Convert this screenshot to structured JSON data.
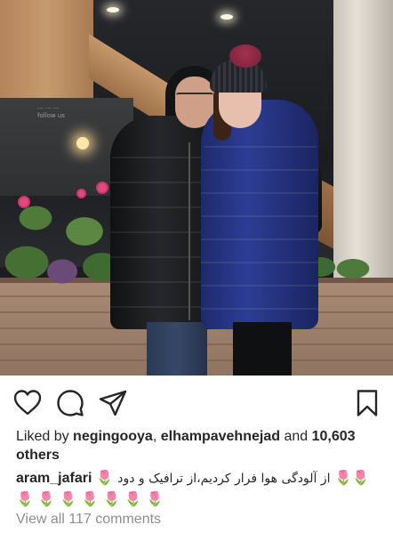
{
  "post": {
    "photo_alt": "",
    "window_sign_lines": [
      "... ... ...",
      "follow us"
    ]
  },
  "actions": {
    "like_icon": "heart-outline-icon",
    "comment_icon": "comment-bubble-icon",
    "share_icon": "paper-plane-icon",
    "save_icon": "bookmark-outline-icon"
  },
  "likes": {
    "prefix": "Liked by ",
    "user1": "negingooya",
    "separator": ", ",
    "user2": "elhampavehnejad",
    "and": " and ",
    "others_count": "10,603",
    "others_word": "others"
  },
  "caption": {
    "username": "aram_jafari",
    "emoji_start": "🌷",
    "text": "از آلودگی هوا فرار کردیم،از ترافیک و دود",
    "emoji_end": "🌷🌷",
    "emoji_row": "🌷 🌷 🌷 🌷 🌷 🌷 🌷"
  },
  "comments": {
    "view_all": "View all 117 comments"
  },
  "colors": {
    "text": "#262626",
    "muted": "#8e8e8e",
    "background": "#ffffff"
  }
}
